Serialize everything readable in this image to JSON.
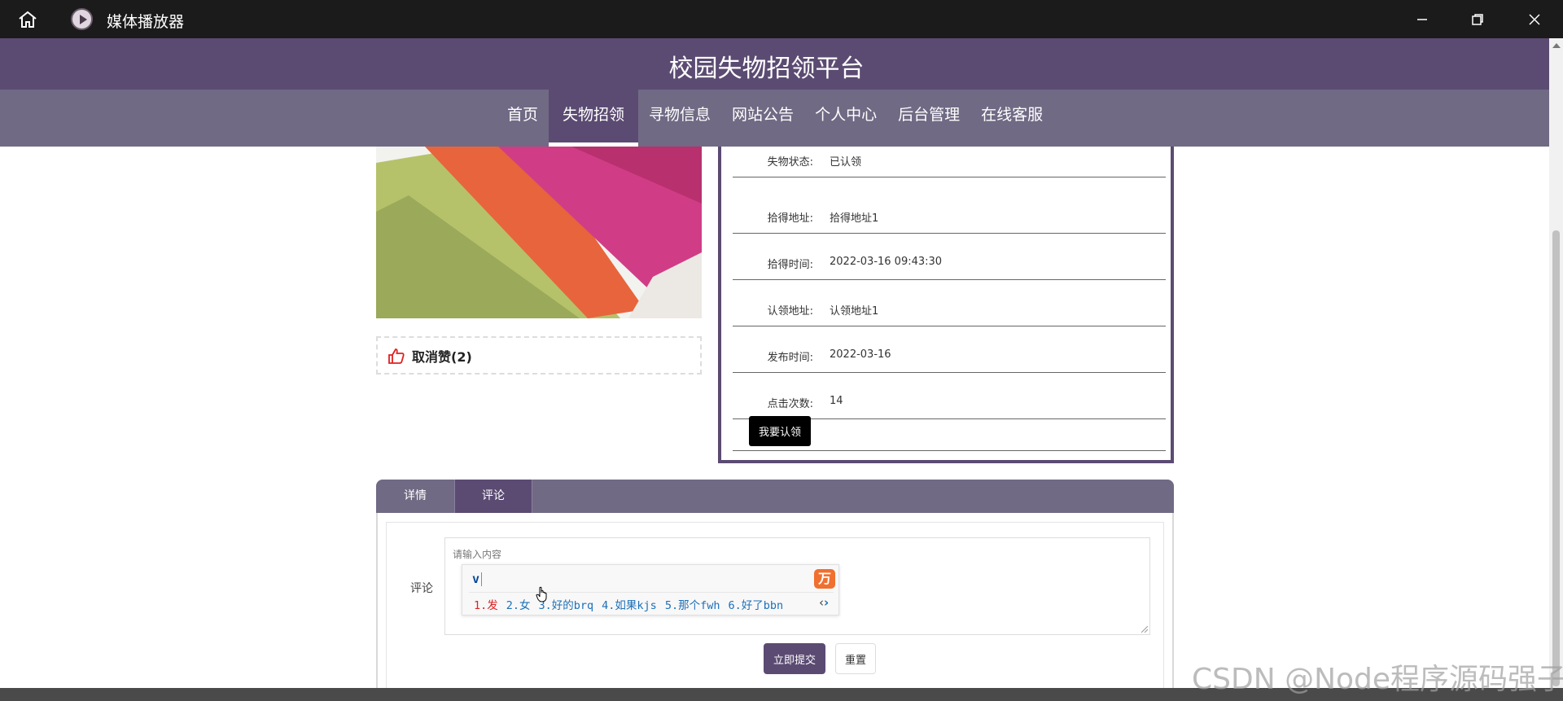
{
  "window": {
    "title": "媒体播放器"
  },
  "site": {
    "title": "校园失物招领平台"
  },
  "nav": {
    "items": [
      {
        "label": "首页"
      },
      {
        "label": "失物招领",
        "active": true
      },
      {
        "label": "寻物信息"
      },
      {
        "label": "网站公告"
      },
      {
        "label": "个人中心"
      },
      {
        "label": "后台管理"
      },
      {
        "label": "在线客服"
      }
    ]
  },
  "like": {
    "label": "取消赞(2)"
  },
  "details": {
    "rows": [
      {
        "label": "失物状态:",
        "value": "已认领"
      },
      {
        "label": "拾得地址:",
        "value": "拾得地址1"
      },
      {
        "label": "拾得时间:",
        "value": "2022-03-16 09:43:30"
      },
      {
        "label": "认领地址:",
        "value": "认领地址1"
      },
      {
        "label": "发布时间:",
        "value": "2022-03-16"
      },
      {
        "label": "点击次数:",
        "value": "14"
      }
    ],
    "claim_button": "我要认领"
  },
  "tabs": [
    {
      "label": "详情"
    },
    {
      "label": "评论",
      "active": true
    }
  ],
  "comment": {
    "label": "评论",
    "placeholder": "请输入内容",
    "submit": "立即提交",
    "reset": "重置"
  },
  "ime": {
    "input": "v",
    "candidates": [
      "1.发",
      "2.女",
      "3.好的brq",
      "4.如果kjs",
      "5.那个fwh",
      "6.好了bbn"
    ],
    "logo": "万"
  },
  "watermark": "CSDN @Node程序源码强子",
  "colors": {
    "primary": "#5b4b72",
    "nav": "#706a84",
    "title_bar": "#1b1b1b"
  }
}
